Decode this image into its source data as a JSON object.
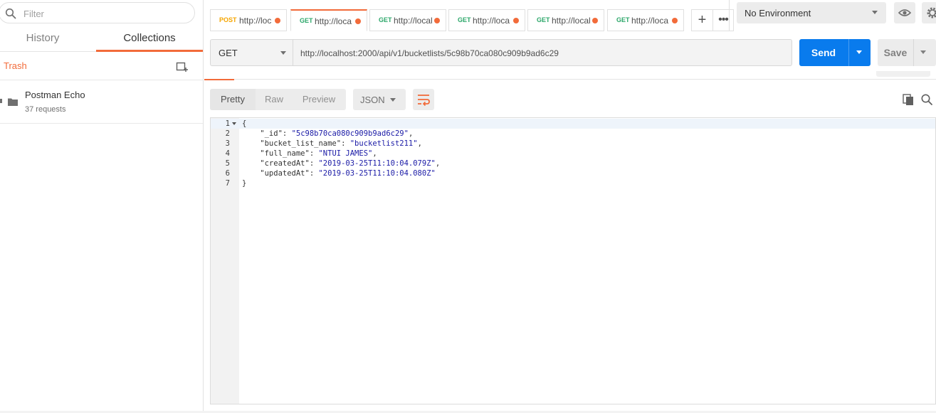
{
  "sidebar": {
    "filter_placeholder": "Filter",
    "tabs": {
      "history": "History",
      "collections": "Collections"
    },
    "trash_label": "Trash",
    "collections": [
      {
        "name": "Postman Echo",
        "count": "37 requests"
      }
    ]
  },
  "request_tabs": [
    {
      "method": "POST",
      "url": "http://loc",
      "active": false
    },
    {
      "method": "GET",
      "url": "http://loca",
      "active": true
    },
    {
      "method": "GET",
      "url": "http://local",
      "active": false
    },
    {
      "method": "GET",
      "url": "http://loca",
      "active": false
    },
    {
      "method": "GET",
      "url": "http://local",
      "active": false
    },
    {
      "method": "GET",
      "url": "http://loca",
      "active": false
    }
  ],
  "tabbar": {
    "plus": "+",
    "more": "•••"
  },
  "environment": {
    "selected": "No Environment"
  },
  "request": {
    "method": "GET",
    "url": "http://localhost:2000/api/v1/bucketlists/5c98b70ca080c909b9ad6c29",
    "send_label": "Send",
    "save_label": "Save"
  },
  "response": {
    "views": {
      "pretty": "Pretty",
      "raw": "Raw",
      "preview": "Preview"
    },
    "format": "JSON",
    "lines": [
      {
        "n": "1",
        "text": "{"
      },
      {
        "n": "2",
        "key": "    \"_id\"",
        "val": "\"5c98b70ca080c909b9ad6c29\"",
        "end": ","
      },
      {
        "n": "3",
        "key": "    \"bucket_list_name\"",
        "val": "\"bucketlist211\"",
        "end": ","
      },
      {
        "n": "4",
        "key": "    \"full_name\"",
        "val": "\"NTUI JAMES\"",
        "end": ","
      },
      {
        "n": "5",
        "key": "    \"createdAt\"",
        "val": "\"2019-03-25T11:10:04.079Z\"",
        "end": ","
      },
      {
        "n": "6",
        "key": "    \"updatedAt\"",
        "val": "\"2019-03-25T11:10:04.080Z\"",
        "end": ""
      },
      {
        "n": "7",
        "text": "}"
      }
    ]
  },
  "colors": {
    "accent": "#f26b3a",
    "send": "#097bed",
    "post": "#f5a500",
    "get": "#2ca76a",
    "json_string": "#1a1aa6"
  }
}
